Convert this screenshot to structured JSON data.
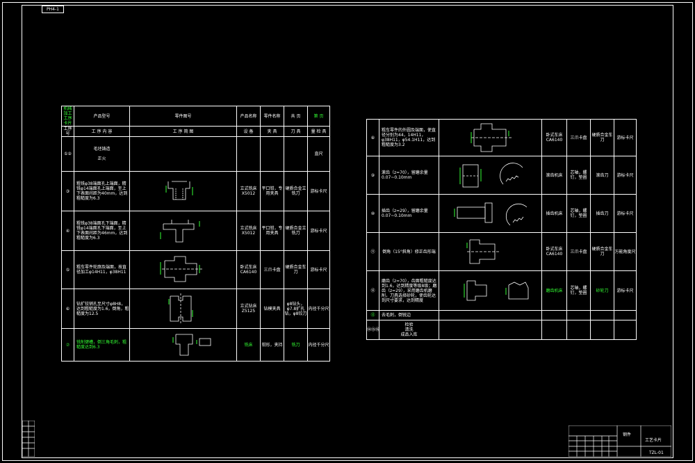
{
  "drawing": {
    "corner_tag": "PH4-1",
    "title_block": {
      "name": "工艺卡片",
      "code": "TZL-01",
      "item": "钢件"
    }
  },
  "left_sheet": {
    "header_cells": [
      "机械加工工序卡片",
      "产品型号",
      "零件图号",
      "产品名称",
      "零件名称",
      "共 页",
      "第 页"
    ],
    "column_headers": [
      "工序号",
      "工 序 内 容",
      "工 序 简 图",
      "设 备",
      "夹 具",
      "刀 具",
      "量 检 具"
    ],
    "rows": [
      {
        "no": "①②",
        "content": "毛坯铸造\n\n正火",
        "equipment": "",
        "fixture": "",
        "tool": "",
        "gauge": "直尺"
      },
      {
        "no": "③",
        "content": "粗铣φ38端面孔上端面，精铣φ14端面孔上端面，至上下表面间距为40mm，达到粗糙度为6.3",
        "equipment": "立式铣床X5012",
        "fixture": "平口钳，专用夹具",
        "tool": "硬质合金立铣刀",
        "gauge": "游标卡尺"
      },
      {
        "no": "④",
        "content": "粗铣φ38端面孔下端面，精铣φ14端面孔下端面，至上下表面间距为46mm，达到粗糙度为6.3",
        "equipment": "立式铣床X5012",
        "fixture": "平口钳，专用夹具",
        "tool": "硬质合金立铣刀",
        "gauge": "游标卡尺"
      },
      {
        "no": "⑤",
        "content": "粗车零件轮廓及端面，按直径加工φ14H11，φ38H11",
        "equipment": "卧式车床CA6140",
        "fixture": "三爪卡盘",
        "tool": "硬质合金车刀",
        "gauge": "游标卡尺"
      },
      {
        "no": "⑥",
        "content": "钻扩铰销孔至尺寸φ8H8，达到粗糙度为1.6，倒角，粗糙度为12.5",
        "equipment": "立式钻床Z5125",
        "fixture": "钻模夹具",
        "tool": "φ8钻头，φ7.8扩孔钻，φ8铰刀",
        "gauge": "内径千分尺"
      },
      {
        "no": "⑦",
        "content": "铣削键槽，倒三角毛刺，粗糙度达到6.3",
        "equipment": "铣床",
        "fixture": "钳形，夹持",
        "tool": "铣刀",
        "gauge": "内径千分尺"
      }
    ]
  },
  "right_sheet": {
    "rows": [
      {
        "no": "⑧",
        "content": "粗车零件的外圆及端面，使直径分别为44，14H11，φ38H11，φ54.1H11，达到粗糙度为3.2",
        "equipment": "卧式车床CA6140",
        "fixture": "三爪卡盘",
        "tool": "硬质合金车刀",
        "gauge": "游标卡尺"
      },
      {
        "no": "⑨",
        "content": "滚齿（z=70），留磨余量0.07~0.10mm",
        "equipment": "滚齿机床",
        "fixture": "芯轴，螺钉，垫圈",
        "tool": "滚齿刀",
        "gauge": "游标卡尺"
      },
      {
        "no": "⑩",
        "content": "插齿（z=29），留磨余量0.07~0.10mm",
        "equipment": "插齿机床",
        "fixture": "芯轴，螺钉，垫圈",
        "tool": "插齿刀",
        "gauge": "游标卡尺"
      },
      {
        "no": "⑪",
        "content": "倒角（15°斜角）修正齿形端",
        "equipment": "卧式车床CA6140",
        "fixture": "三爪卡盘",
        "tool": "硬质合金车刀",
        "gauge": "万能角度尺"
      },
      {
        "no": "⑫",
        "content": "磨齿（z=70），齿面粗糙度达到1.6，达到精度等级8级；磨齿（z=29），采用磨齿机磨削，刀具选择砂轮，使齿轮达到尺寸要求，达到精度",
        "equipment": "磨齿机床",
        "fixture": "芯轴，螺钉，垫圈",
        "tool": "砂轮刀",
        "gauge": "游标卡尺"
      },
      {
        "no": "⑬",
        "content": "去毛刺，倒锐边",
        "equipment": "",
        "fixture": "",
        "tool": "",
        "gauge": ""
      },
      {
        "no": "⑭⑮⑯",
        "content": "检验\n清洗\n成品入库",
        "equipment": "",
        "fixture": "",
        "tool": "",
        "gauge": ""
      }
    ]
  }
}
